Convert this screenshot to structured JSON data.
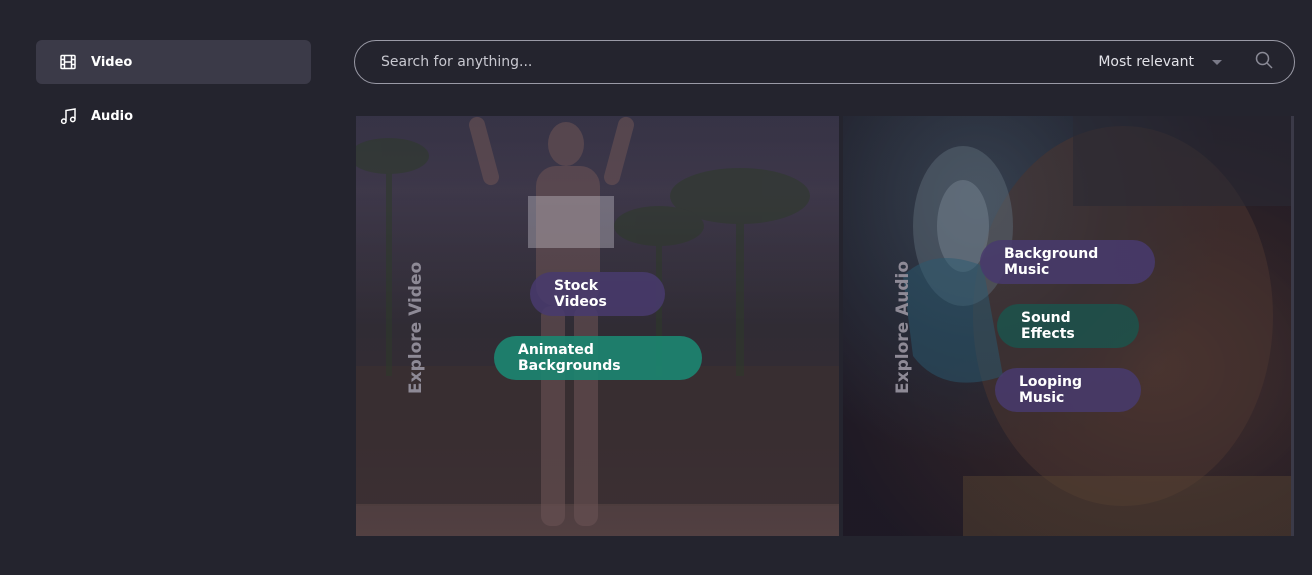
{
  "sidebar": {
    "items": [
      {
        "label": "Video",
        "icon": "film-icon",
        "active": true
      },
      {
        "label": "Audio",
        "icon": "music-note-icon",
        "active": false
      }
    ]
  },
  "search": {
    "placeholder": "Search for anything...",
    "sort_label": "Most relevant",
    "icon": "search-icon"
  },
  "video_panel": {
    "heading": "Explore Video",
    "tags": [
      "Stock Videos",
      "Animated Backgrounds"
    ]
  },
  "audio_panel": {
    "heading": "Explore Audio",
    "tags": [
      "Background Music",
      "Sound Effects",
      "Looping Music"
    ]
  },
  "colors": {
    "background": "#24242e",
    "active_item": "#3b3a48",
    "pill_purple": "#483a6c",
    "pill_green": "#1c8470",
    "pill_teal": "#1e504a"
  }
}
